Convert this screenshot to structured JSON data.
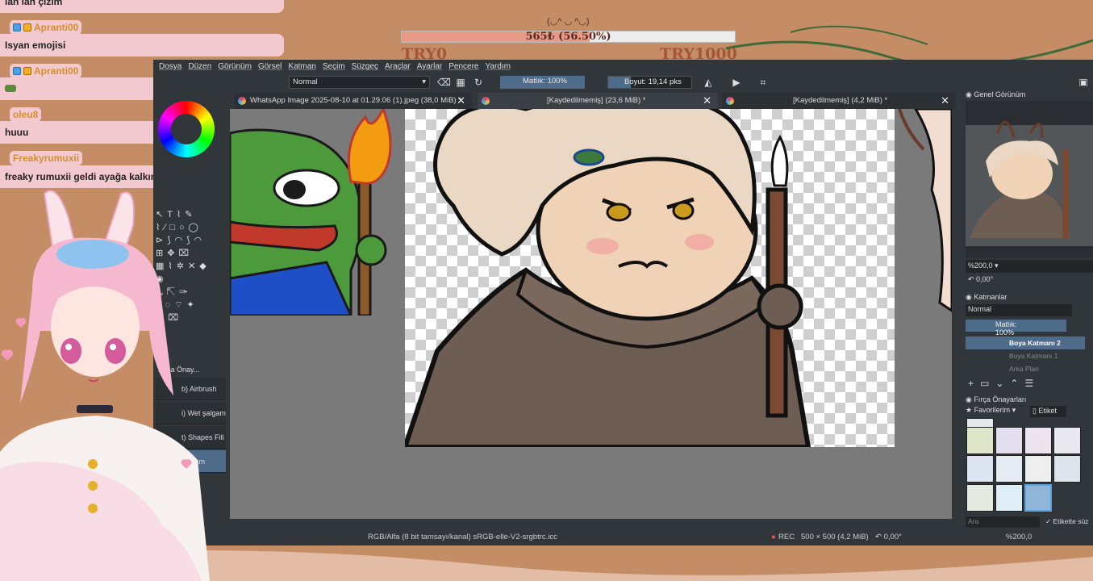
{
  "chat": {
    "messages": [
      {
        "user": "",
        "text": "lan lan çizim"
      },
      {
        "user": "Apranti00",
        "text": "Isyan emojisi"
      },
      {
        "user": "Apranti00",
        "text": ""
      },
      {
        "user": "oleu8",
        "text": "huuu"
      },
      {
        "user": "Freakyrumuxii",
        "text": "freaky rumuxii geldi ayağa kalkın"
      }
    ]
  },
  "goal": {
    "emote": "(◡^ ◡ ^◡)",
    "text": "565₺ (56.50%)",
    "progress": 0.565,
    "left_label": "TRY0",
    "right_label": "TRY1000"
  },
  "menu": [
    "Dosya",
    "Düzen",
    "Görünüm",
    "Görsel",
    "Katman",
    "Seçim",
    "Süzgeç",
    "Araçlar",
    "Ayarlar",
    "Pencere",
    "Yardım"
  ],
  "tool_options": {
    "blend_mode": "Normal",
    "opacity": "Matlık: 100%",
    "size": "Boyut: 19,14 pks"
  },
  "tabs": [
    {
      "title": "WhatsApp Image 2025-08-10 at 01.29.06 (1).jpeg (38,0 MiB) *"
    },
    {
      "title": "[Kaydedilmemiş]  (23,6 MiB) *"
    },
    {
      "title": "[Kaydedilmemiş]  (4,2 MiB) *"
    }
  ],
  "brush_presets_left": {
    "title": "Fırça Önay...",
    "items": [
      "b) Airbrush Soft",
      "i) Wet şalgam",
      "t) Shapes Fill",
      "şalgam"
    ]
  },
  "overview": {
    "title": "Genel Görünüm",
    "zoom": "%200,0",
    "rotation": "0,00°"
  },
  "layers": {
    "title": "Katmanlar",
    "blend": "Normal",
    "opacity": "Matlık:  100%",
    "items": [
      {
        "name": "Boya Katmanı 2",
        "active": true
      },
      {
        "name": "Boya Katmanı 1",
        "active": false
      },
      {
        "name": "Arka Plan",
        "active": false
      }
    ]
  },
  "brush_presets_right": {
    "title": "Fırça Önayarları",
    "tag": "Favorilerim",
    "tag_button": "Etiket",
    "search_placeholder": "Ara",
    "filter_label": "Etikette süz"
  },
  "status": {
    "color_profile": "RGB/Alfa (8 bit tamsayı/kanal)  sRGB-elle-V2-srgbtrc.icc",
    "rec": "REC",
    "doc_size": "500 × 500 (4,2 MiB)",
    "rotation": "0,00°",
    "zoom": "%200,0"
  },
  "colors": {
    "accent": "#4f6b8a",
    "chat_bg": "#f2c9cf",
    "panel": "#31363b"
  }
}
